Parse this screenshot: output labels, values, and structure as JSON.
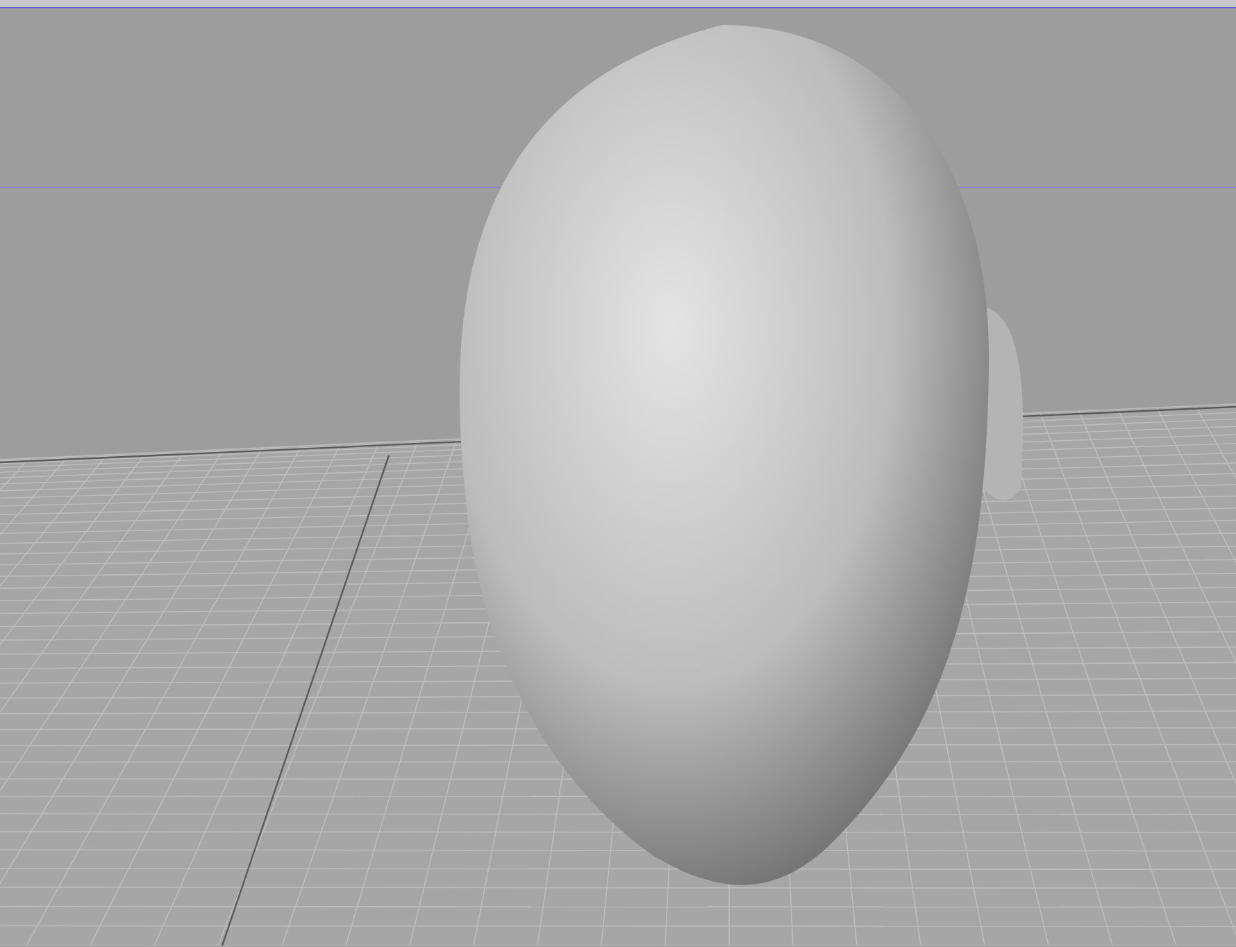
{
  "viewport": {
    "grid_visible": true,
    "model_visible": true
  }
}
